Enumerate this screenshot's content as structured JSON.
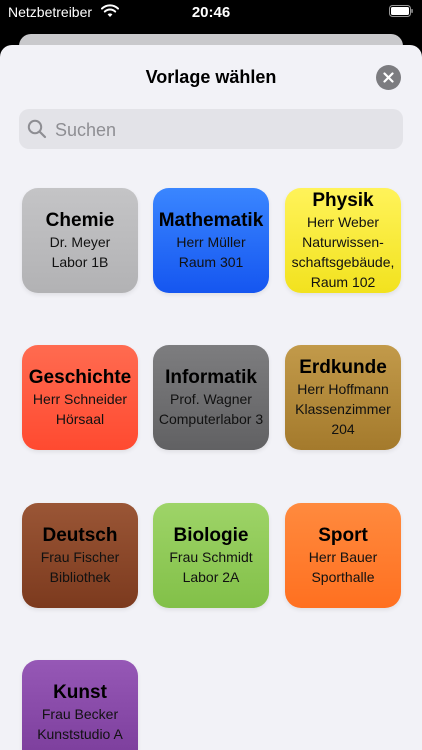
{
  "status": {
    "carrier": "Netzbetreiber",
    "time": "20:46"
  },
  "sheet": {
    "title": "Vorlage wählen"
  },
  "search": {
    "placeholder": "Suchen"
  },
  "templates": [
    {
      "name": "Chemie",
      "teacher": "Dr. Meyer",
      "room": "Labor 1B",
      "color_top": "#c4c4c6",
      "color_bottom": "#b2b2b4"
    },
    {
      "name": "Mathematik",
      "teacher": "Herr Müller",
      "room": "Raum 301",
      "color_top": "#3a86ff",
      "color_bottom": "#1556f0"
    },
    {
      "name": "Physik",
      "teacher": "Herr Weber",
      "room_lines": [
        "Naturwissen-",
        "schaftsgebäude,",
        "Raum 102"
      ],
      "color_top": "#fff35a",
      "color_bottom": "#f2e21e"
    },
    {
      "name": "Geschichte",
      "teacher": "Herr Schneider",
      "room": "Hörsaal",
      "color_top": "#ff6b50",
      "color_bottom": "#ff4a30"
    },
    {
      "name": "Informatik",
      "teacher": "Prof. Wagner",
      "room": "Computerlabor 3",
      "color_top": "#7d7d7f",
      "color_bottom": "#616163"
    },
    {
      "name": "Erdkunde",
      "teacher": "Herr Hoffmann",
      "room_lines": [
        "Klassenzimmer",
        "204"
      ],
      "color_top": "#c29a4a",
      "color_bottom": "#a47a2c"
    },
    {
      "name": "Deutsch",
      "teacher": "Frau Fischer",
      "room": "Bibliothek",
      "color_top": "#9a5636",
      "color_bottom": "#7c3a1e"
    },
    {
      "name": "Biologie",
      "teacher": "Frau Schmidt",
      "room": "Labor 2A",
      "color_top": "#9ed468",
      "color_bottom": "#82c048"
    },
    {
      "name": "Sport",
      "teacher": "Herr Bauer",
      "room": "Sporthalle",
      "color_top": "#ff8a3e",
      "color_bottom": "#ff7020"
    },
    {
      "name": "Kunst",
      "teacher": "Frau Becker",
      "room": "Kunststudio A",
      "color_top": "#9658b6",
      "color_bottom": "#7a3c9a"
    }
  ]
}
